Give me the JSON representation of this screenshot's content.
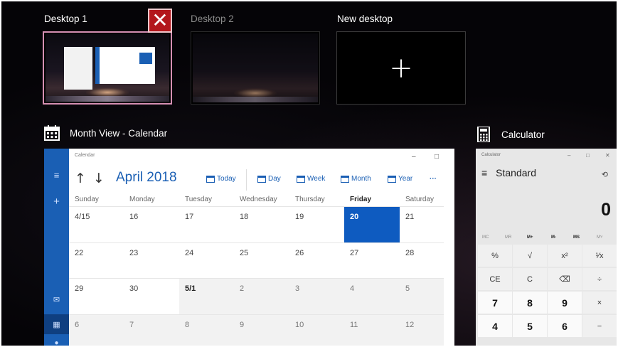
{
  "desktops": {
    "items": [
      {
        "label": "Desktop 1"
      },
      {
        "label": "Desktop 2"
      },
      {
        "label": "New desktop"
      }
    ],
    "close_glyph": "✕",
    "plus_glyph": "+"
  },
  "calendar_window": {
    "title": "Month View - Calendar",
    "app_name": "Calendar",
    "controls": [
      "–",
      "□",
      "✕"
    ],
    "month_label": "April 2018",
    "toolbar": {
      "today": "Today",
      "day": "Day",
      "week": "Week",
      "month": "Month",
      "year": "Year",
      "more": "···"
    },
    "days_of_week": [
      "Sunday",
      "Monday",
      "Tuesday",
      "Wednesday",
      "Thursday",
      "Friday",
      "Saturday"
    ],
    "weeks": [
      [
        "4/15",
        "16",
        "17",
        "18",
        "19",
        "20",
        "21"
      ],
      [
        "22",
        "23",
        "24",
        "25",
        "26",
        "27",
        "28"
      ],
      [
        "29",
        "30",
        "5/1",
        "2",
        "3",
        "4",
        "5"
      ],
      [
        "6",
        "7",
        "8",
        "9",
        "10",
        "11",
        "12"
      ]
    ],
    "accent_color": "#1a5fb4"
  },
  "calculator_window": {
    "title": "Calculator",
    "app_name": "Calculator",
    "controls": [
      "–",
      "□",
      "✕"
    ],
    "mode": "Standard",
    "display": "0",
    "memory": [
      "MC",
      "MR",
      "M+",
      "M-",
      "MS",
      "M˅"
    ],
    "keys": [
      [
        "%",
        "√",
        "x²",
        "¹⁄x"
      ],
      [
        "CE",
        "C",
        "⌫",
        "÷"
      ],
      [
        "7",
        "8",
        "9",
        "×"
      ],
      [
        "4",
        "5",
        "6",
        "−"
      ]
    ]
  }
}
